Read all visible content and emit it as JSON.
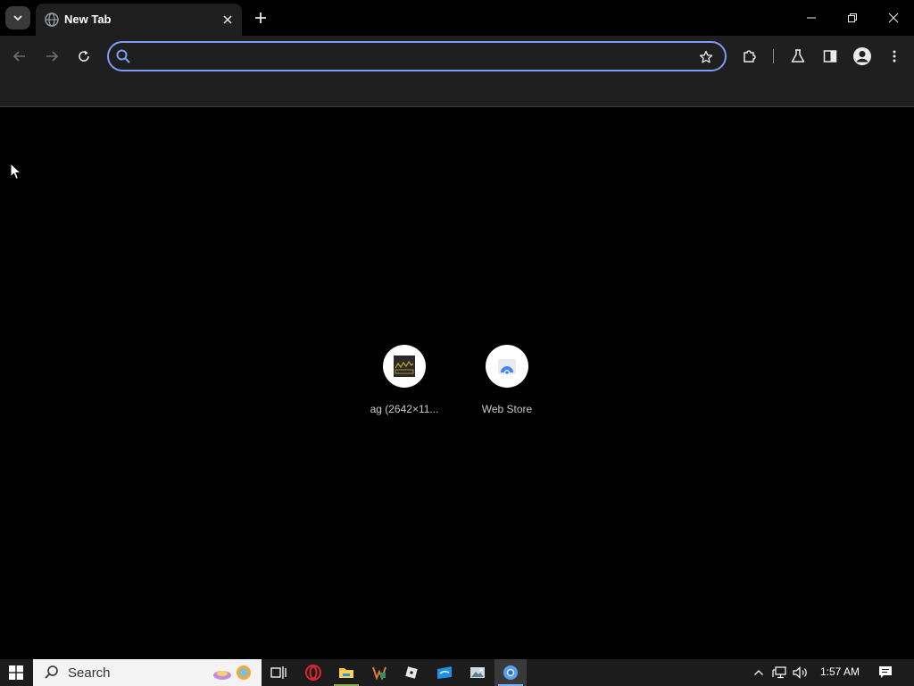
{
  "tab": {
    "title": "New Tab"
  },
  "omnibox": {
    "value": "",
    "placeholder": ""
  },
  "tiles": [
    {
      "label": "ag (2642×11..."
    },
    {
      "label": "Web Store"
    }
  ],
  "taskbar": {
    "search_text": "Search",
    "clock": "1:57 AM"
  },
  "colors": {
    "focus_ring": "#7c9cf5",
    "toolbar_bg": "#1f1f1f",
    "page_bg": "#000000"
  }
}
